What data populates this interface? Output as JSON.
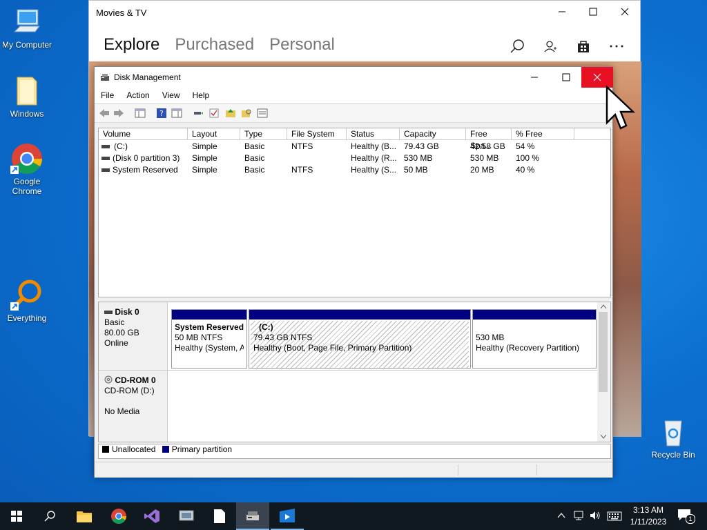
{
  "desktop": {
    "icons": [
      {
        "label": "My Computer",
        "name": "my-computer"
      },
      {
        "label": "Windows",
        "name": "windows-folder"
      },
      {
        "label": "Google Chrome",
        "name": "google-chrome"
      },
      {
        "label": "Everything",
        "name": "everything"
      },
      {
        "label": "Recycle Bin",
        "name": "recycle-bin"
      }
    ]
  },
  "movies": {
    "title": "Movies & TV",
    "tabs": [
      "Explore",
      "Purchased",
      "Personal"
    ],
    "active_tab": "Explore"
  },
  "diskmgmt": {
    "title": "Disk Management",
    "menu": [
      "File",
      "Action",
      "View",
      "Help"
    ],
    "columns": [
      "Volume",
      "Layout",
      "Type",
      "File System",
      "Status",
      "Capacity",
      "Free Spa...",
      "% Free"
    ],
    "rows": [
      [
        "(C:)",
        "Simple",
        "Basic",
        "NTFS",
        "Healthy (B...",
        "79.43 GB",
        "42.58 GB",
        "54 %"
      ],
      [
        "(Disk 0 partition 3)",
        "Simple",
        "Basic",
        "",
        "Healthy (R...",
        "530 MB",
        "530 MB",
        "100 %"
      ],
      [
        "System Reserved",
        "Simple",
        "Basic",
        "NTFS",
        "Healthy (S...",
        "50 MB",
        "20 MB",
        "40 %"
      ]
    ],
    "disk0": {
      "name": "Disk 0",
      "type": "Basic",
      "size": "80.00 GB",
      "state": "Online",
      "partitions": [
        {
          "name": "System Reserved",
          "size": "50 MB NTFS",
          "status": "Healthy (System, A"
        },
        {
          "name": "(C:)",
          "size": "79.43 GB NTFS",
          "status": "Healthy (Boot, Page File, Primary Partition)"
        },
        {
          "name": "",
          "size": "530 MB",
          "status": "Healthy (Recovery Partition)"
        }
      ]
    },
    "cdrom": {
      "name": "CD-ROM 0",
      "drive": "CD-ROM (D:)",
      "media": "No Media"
    },
    "legend": {
      "unallocated": "Unallocated",
      "primary": "Primary partition",
      "unallocated_color": "#000000",
      "primary_color": "#000080"
    }
  },
  "taskbar": {
    "time": "3:13 AM",
    "date": "1/11/2023",
    "notification_count": "1"
  },
  "colors": {
    "close_hover": "#e81123",
    "desktop": "#0a6fd0",
    "taskbar": "#101820"
  }
}
